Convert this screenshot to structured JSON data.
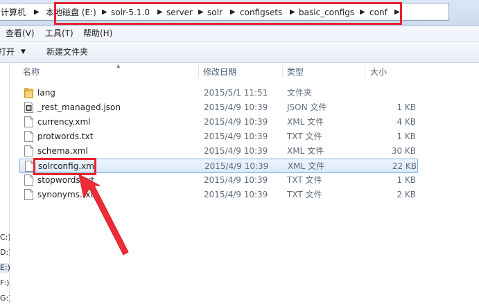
{
  "address_bar": {
    "crumbs": [
      "计算机",
      "本地磁盘 (E:)",
      "solr-5.1.0",
      "server",
      "solr",
      "configsets",
      "basic_configs",
      "conf"
    ]
  },
  "menu": {
    "items": [
      "查看(V)",
      "工具(T)",
      "帮助(H)"
    ]
  },
  "toolbar": {
    "open_label": "打开",
    "new_folder_label": "新建文件夹"
  },
  "nav": {
    "drives": [
      "C:)",
      "D:)",
      "E:)",
      "F:)",
      "G:)"
    ]
  },
  "columns": {
    "name": "名称",
    "date": "修改日期",
    "type": "类型",
    "size": "大小"
  },
  "files": [
    {
      "name": "lang",
      "date": "2015/5/1 11:51",
      "type": "文件夹",
      "size": "",
      "icon": "folder-icon"
    },
    {
      "name": "_rest_managed.json",
      "date": "2015/4/9 10:39",
      "type": "JSON 文件",
      "size": "1 KB",
      "icon": "json-file-icon"
    },
    {
      "name": "currency.xml",
      "date": "2015/4/9 10:39",
      "type": "XML 文件",
      "size": "4 KB",
      "icon": "file-icon"
    },
    {
      "name": "protwords.txt",
      "date": "2015/4/9 10:39",
      "type": "TXT 文件",
      "size": "1 KB",
      "icon": "file-icon"
    },
    {
      "name": "schema.xml",
      "date": "2015/4/9 10:39",
      "type": "XML 文件",
      "size": "30 KB",
      "icon": "file-icon"
    },
    {
      "name": "solrconfig.xml",
      "date": "2015/4/9 10:39",
      "type": "XML 文件",
      "size": "22 KB",
      "icon": "file-icon",
      "selected": true
    },
    {
      "name": "stopwords.txt",
      "date": "2015/4/9 10:39",
      "type": "TXT 文件",
      "size": "1 KB",
      "icon": "file-icon"
    },
    {
      "name": "synonyms.txt",
      "date": "2015/4/9 10:39",
      "type": "TXT 文件",
      "size": "2 KB",
      "icon": "file-icon"
    }
  ],
  "colors": {
    "annotation_red": "#e8232d",
    "selection_border": "#84acdd"
  }
}
